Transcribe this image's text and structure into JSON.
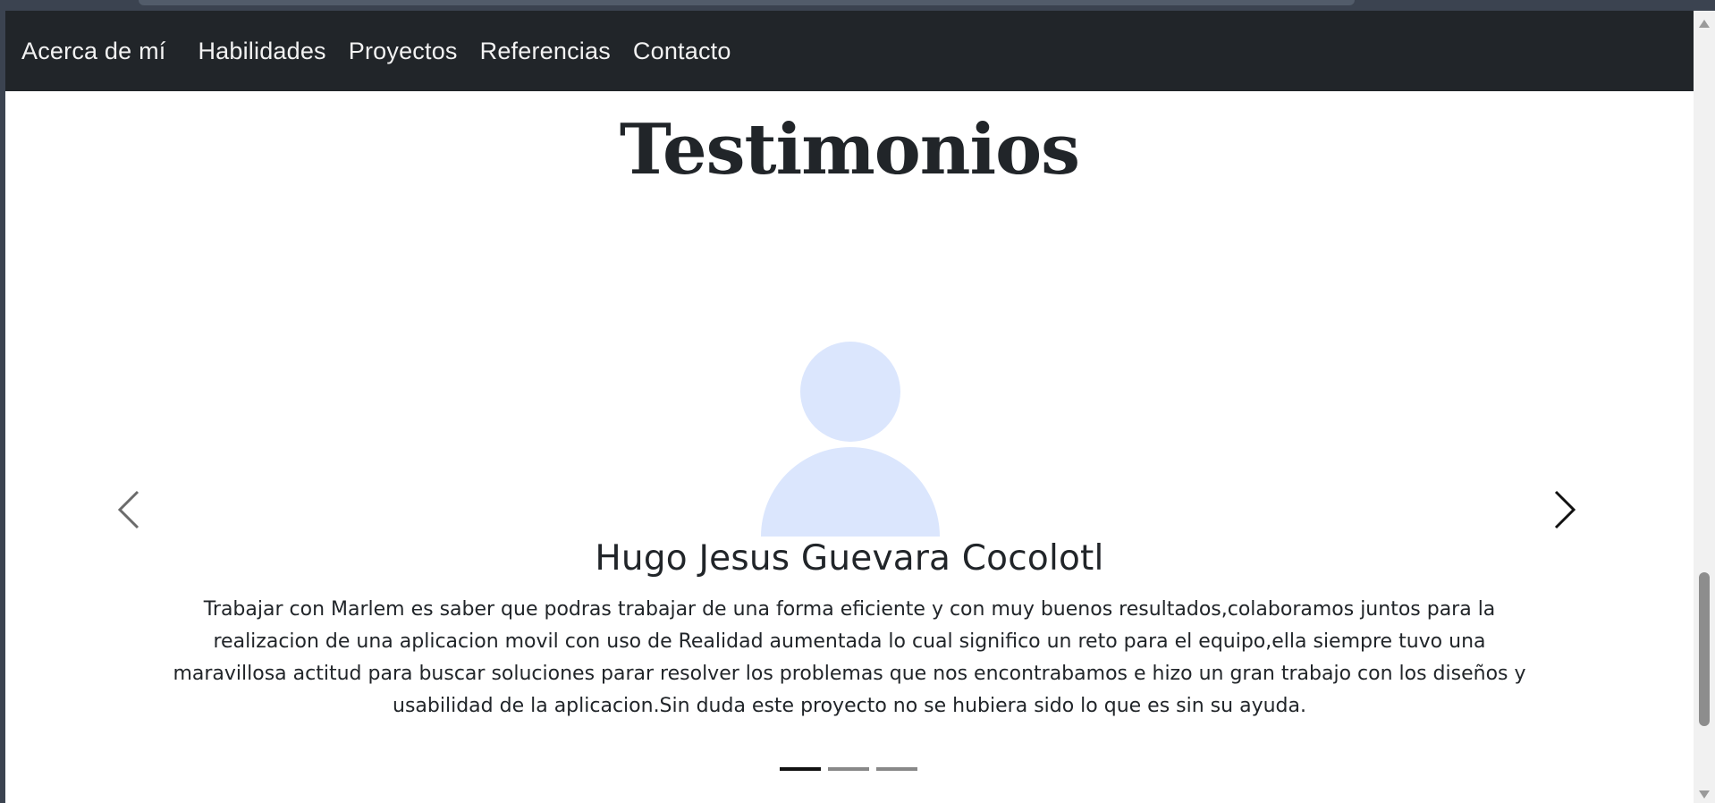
{
  "nav": {
    "items": [
      {
        "label": "Acerca de mí"
      },
      {
        "label": "Habilidades"
      },
      {
        "label": "Proyectos"
      },
      {
        "label": "Referencias"
      },
      {
        "label": "Contacto"
      }
    ]
  },
  "section": {
    "title": "Testimonios"
  },
  "testimonial": {
    "avatar_icon": "person-placeholder-icon",
    "name": "Hugo Jesus Guevara Cocolotl",
    "text": "Trabajar con Marlem es saber que podras trabajar de una forma eficiente y con muy buenos resultados,colaboramos juntos para la realizacion de una aplicacion movil con uso de Realidad aumentada lo cual significo un reto para el equipo,ella siempre tuvo una maravillosa actitud para buscar soluciones parar resolver los problemas que nos encontrabamos e hizo un gran trabajo con los diseños y usabilidad de la aplicacion.Sin duda este proyecto no se hubiera sido lo que es sin su ayuda."
  },
  "carousel": {
    "slide_count": 3,
    "active_index": 0,
    "prev_icon": "chevron-left-icon",
    "next_icon": "chevron-right-icon"
  },
  "colors": {
    "navbar_bg": "#212529",
    "avatar": "#dbe6fd",
    "text": "#212529"
  }
}
